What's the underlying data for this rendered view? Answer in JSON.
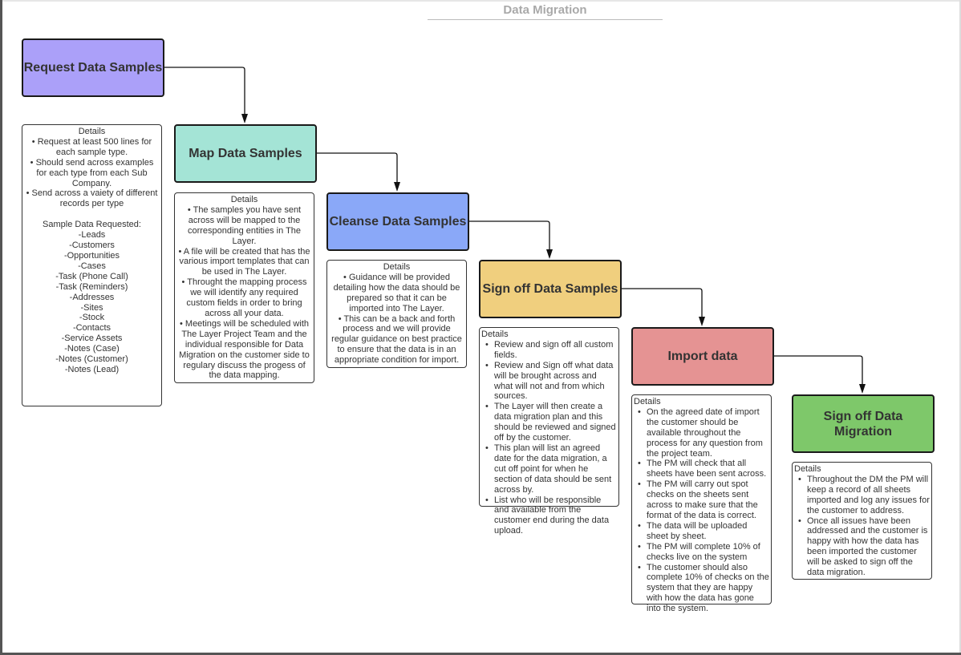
{
  "title": "Data Migration",
  "colors": {
    "request": "#aba0f9",
    "map": "#a4e4d6",
    "cleanse": "#8aa8f8",
    "signoff_samples": "#f0cf7e",
    "import": "#e59393",
    "signoff_migration": "#7ec86a"
  },
  "steps": [
    {
      "title": "Request Data Samples",
      "details_heading": "Details",
      "bullets": [
        "Request at least 500 lines for each sample type.",
        "Should send across examples for each type from each Sub Company.",
        "Send across a vaiety of different records per type"
      ],
      "samples_heading": "Sample Data Requested:",
      "samples": [
        "-Leads",
        "-Customers",
        "-Opportunities",
        "-Cases",
        "-Task (Phone Call)",
        "-Task (Reminders)",
        "-Addresses",
        "-Sites",
        "-Stock",
        "-Contacts",
        "-Service Assets",
        "-Notes (Case)",
        "-Notes (Customer)",
        "-Notes (Lead)"
      ]
    },
    {
      "title": "Map Data Samples",
      "details_heading": "Details",
      "bullets": [
        "The samples you have sent across will be mapped to the corresponding entities in The Layer.",
        "A  file will be created that has the various import templates that can be used in The Layer.",
        "Throught the mapping process we will identify any required custom fields in order to bring across all your data.",
        "Meetings will be scheduled with The Layer Project Team and the individual responsible for Data Migration on the customer side to regulary discuss the progess of the data mapping."
      ]
    },
    {
      "title": "Cleanse Data Samples",
      "details_heading": "Details",
      "bullets": [
        "Guidance will be provided detailing how the data should be prepared so that it can be imported into The Layer.",
        "This can be a back and forth process and we will provide regular guidance on best practice to ensure that the data is in an appropriate condition for import."
      ]
    },
    {
      "title": "Sign off Data Samples",
      "details_heading": "Details",
      "bullets": [
        "Review and sign off all custom fields.",
        "Review and Sign off what data will be brought across and what will not and from which sources.",
        "The Layer will then create a data migration plan and this should be reviewed and signed off by the customer.",
        "This plan will list an agreed date for the data migration, a cut off point for when he section of data should be sent across by.",
        "List who will be responsible and available from the customer end during the data upload."
      ]
    },
    {
      "title": "Import data",
      "details_heading": "Details",
      "bullets": [
        "On the agreed date of import the customer should be available throughout the process for any question from the project team.",
        "The PM will check that all sheets have been sent across.",
        "The PM will carry out spot checks on the sheets sent across to make sure that the format of the data is correct.",
        "The data will be uploaded sheet by sheet.",
        "The PM will complete 10% of checks live on the system",
        "The customer should also complete 10% of checks on the system that they are happy with how the data has gone into the system."
      ]
    },
    {
      "title": "Sign off Data Migration",
      "details_heading": "Details",
      "bullets": [
        "Throughout the DM the PM will keep a record of all sheets imported and log any issues for the customer to address.",
        "Once all issues have been addressed and the customer is happy with how the data has been imported the customer will be asked to sign off the data migration."
      ]
    }
  ]
}
